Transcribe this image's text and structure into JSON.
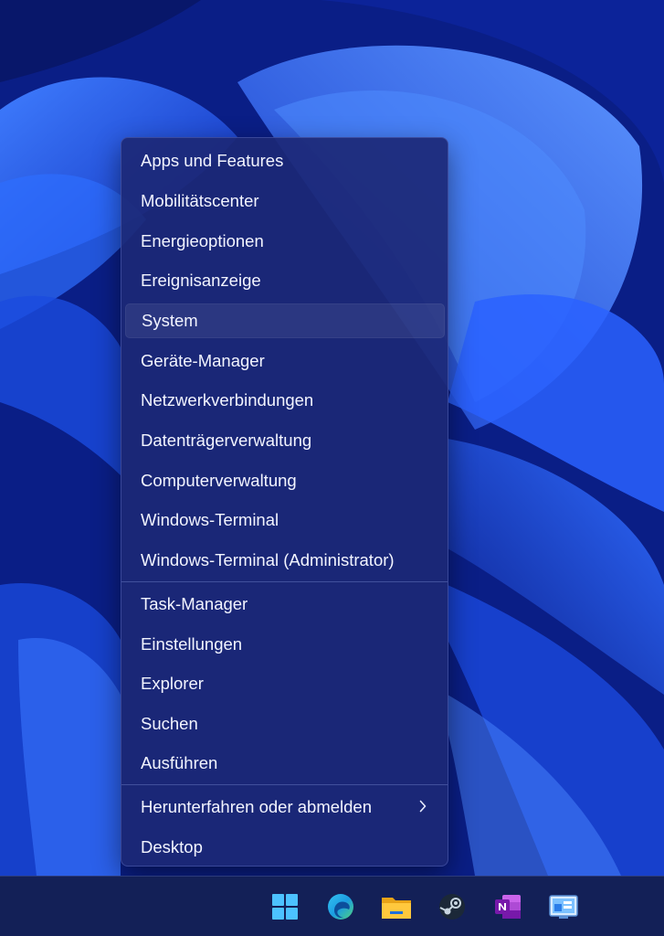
{
  "context_menu": {
    "group1": [
      {
        "label": "Apps und Features"
      },
      {
        "label": "Mobilitätscenter"
      },
      {
        "label": "Energieoptionen"
      },
      {
        "label": "Ereignisanzeige"
      },
      {
        "label": "System"
      },
      {
        "label": "Geräte-Manager"
      },
      {
        "label": "Netzwerkverbindungen"
      },
      {
        "label": "Datenträgerverwaltung"
      },
      {
        "label": "Computerverwaltung"
      },
      {
        "label": "Windows-Terminal"
      },
      {
        "label": "Windows-Terminal (Administrator)"
      }
    ],
    "group2": [
      {
        "label": "Task-Manager"
      },
      {
        "label": "Einstellungen"
      },
      {
        "label": "Explorer"
      },
      {
        "label": "Suchen"
      },
      {
        "label": "Ausführen"
      }
    ],
    "group3": [
      {
        "label": "Herunterfahren oder abmelden",
        "has_submenu": true
      },
      {
        "label": "Desktop"
      }
    ],
    "highlighted_item": "System"
  },
  "taskbar": {
    "icons": [
      {
        "name": "windows-start-icon"
      },
      {
        "name": "edge-icon"
      },
      {
        "name": "file-explorer-icon"
      },
      {
        "name": "steam-icon"
      },
      {
        "name": "onenote-icon"
      },
      {
        "name": "control-panel-icon"
      }
    ]
  },
  "colors": {
    "wallpaper_primary": "#1b4fe6",
    "wallpaper_dark": "#07135a",
    "menu_background": "#1c2876",
    "menu_text": "#f2f4ff",
    "taskbar_background": "#132057"
  }
}
